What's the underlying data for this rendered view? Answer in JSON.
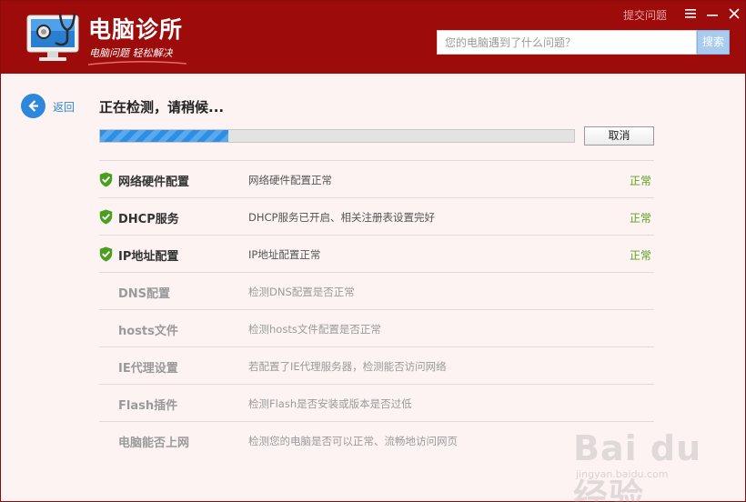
{
  "app": {
    "title": "电脑诊所",
    "subtitle": "电脑问题 轻松解决"
  },
  "titlebar": {
    "help_label": "提交问题"
  },
  "search": {
    "placeholder": "您的电脑遇到了什么问题？",
    "value": "",
    "button_label": "搜索"
  },
  "nav": {
    "back_label": "返回"
  },
  "scan": {
    "status_text": "正在检测，请稍候...",
    "progress": 0.27,
    "cancel_label": "取消"
  },
  "checks": [
    {
      "name": "网络硬件配置",
      "description": "网络硬件配置正常",
      "result": "正常",
      "state": "done"
    },
    {
      "name": "DHCP服务",
      "description": "DHCP服务已开启、相关注册表设置完好",
      "result": "正常",
      "state": "done"
    },
    {
      "name": "IP地址配置",
      "description": "IP地址配置正常",
      "result": "正常",
      "state": "done"
    },
    {
      "name": "DNS配置",
      "description": "检测DNS配置是否正常",
      "result": "",
      "state": "pending"
    },
    {
      "name": "hosts文件",
      "description": "检测hosts文件配置是否正常",
      "result": "",
      "state": "pending"
    },
    {
      "name": "IE代理设置",
      "description": "若配置了IE代理服务器，检测能否访问网络",
      "result": "",
      "state": "pending"
    },
    {
      "name": "Flash插件",
      "description": "检测Flash是否安装或版本是否过低",
      "result": "",
      "state": "pending"
    },
    {
      "name": "电脑能否上网",
      "description": "检测您的电脑是否可以正常、流畅地访问网页",
      "result": "",
      "state": "pending"
    }
  ],
  "watermark": {
    "text": "Bai du 经验",
    "url": "jingyan.baidu.com"
  },
  "colors": {
    "header": "#9d0b0b",
    "accent": "#2d87db",
    "ok": "#5ba21e",
    "shield": "#4a9f1f"
  },
  "icons": [
    "clinic-logo-icon",
    "menu-icon",
    "minimize-icon",
    "close-icon",
    "back-arrow-icon",
    "shield-check-icon"
  ]
}
